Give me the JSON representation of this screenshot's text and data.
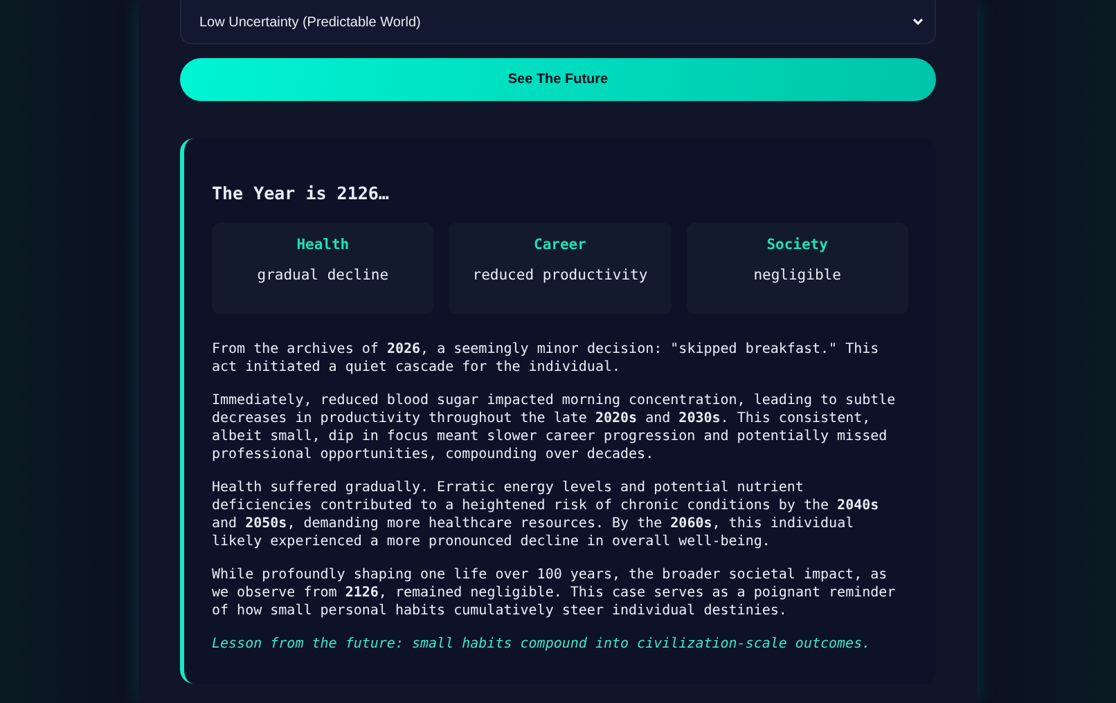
{
  "uncertainty_select": {
    "value": "Low Uncertainty (Predictable World)"
  },
  "action_button": {
    "label": "See The Future"
  },
  "result": {
    "title": "The Year is 2126…",
    "stats": [
      {
        "label": "Health",
        "value": "gradual decline"
      },
      {
        "label": "Career",
        "value": "reduced productivity"
      },
      {
        "label": "Society",
        "value": "negligible"
      }
    ],
    "paragraphs": [
      "From the archives of **2026**, a seemingly minor decision: \"skipped breakfast.\" This act initiated a quiet cascade for the individual.",
      "Immediately, reduced blood sugar impacted morning concentration, leading to subtle decreases in productivity throughout the late **2020s** and **2030s**. This consistent, albeit small, dip in focus meant slower career progression and potentially missed professional opportunities, compounding over decades.",
      "Health suffered gradually. Erratic energy levels and potential nutrient deficiencies contributed to a heightened risk of chronic conditions by the **2040s** and **2050s**, demanding more healthcare resources. By the **2060s**, this individual likely experienced a more pronounced decline in overall well-being.",
      "While profoundly shaping one life over 100 years, the broader societal impact, as we observe from **2126**, remained negligible. This case serves as a poignant reminder of how small personal habits cumulatively steer individual destinies."
    ],
    "lesson": "Lesson from the future: small habits compound into civilization-scale outcomes."
  }
}
